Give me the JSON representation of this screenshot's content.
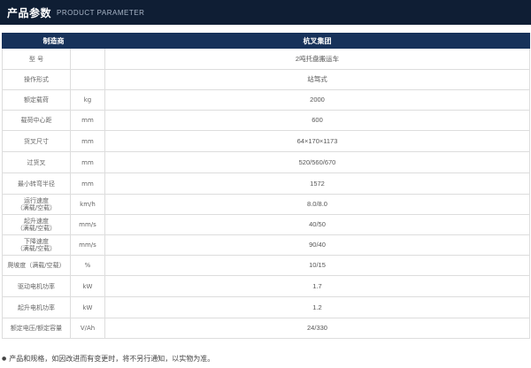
{
  "header": {
    "title_zh": "产品参数",
    "title_en": "PRODUCT PARAMETER"
  },
  "table": {
    "head_left": "制造商",
    "head_right": "杭叉集团",
    "rows": [
      {
        "label": "型 号",
        "unit": "",
        "value": "2吨托盘搬运车"
      },
      {
        "label": "操作形式",
        "unit": "",
        "value": "站驾式"
      },
      {
        "label": "额定载荷",
        "unit": "kg",
        "value": "2000"
      },
      {
        "label": "载荷中心距",
        "unit": "mm",
        "value": "600"
      },
      {
        "label": "货叉尺寸",
        "unit": "mm",
        "value": "64×170×1173"
      },
      {
        "label": "过货叉",
        "unit": "mm",
        "value": "520/560/670"
      },
      {
        "label": "最小转弯半径",
        "unit": "mm",
        "value": "1572"
      },
      {
        "label": "运行速度\n（满载/空载）",
        "unit": "km/h",
        "value": "8.0/8.0"
      },
      {
        "label": "起升速度\n（满载/空载）",
        "unit": "mm/s",
        "value": "40/50"
      },
      {
        "label": "下降速度\n（满载/空载）",
        "unit": "mm/s",
        "value": "90/40"
      },
      {
        "label": "爬坡度（满载/空载）",
        "unit": "%",
        "value": "10/15"
      },
      {
        "label": "驱动电机功率",
        "unit": "kW",
        "value": "1.7"
      },
      {
        "label": "起升电机功率",
        "unit": "kW",
        "value": "1.2"
      },
      {
        "label": "额定电压/额定容量",
        "unit": "V/Ah",
        "value": "24/330"
      }
    ]
  },
  "footnote": {
    "text": "产品和规格，如因改进而有变更时，将不另行通知，以实物为准。"
  }
}
